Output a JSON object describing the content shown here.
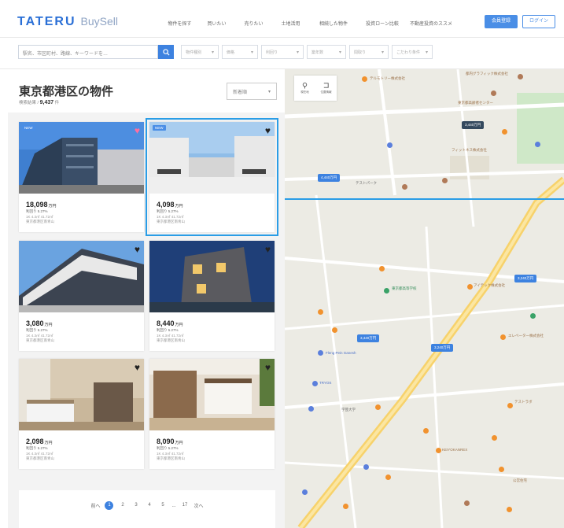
{
  "header": {
    "logo": "TATERU",
    "logo_sub": "BuySell",
    "nav": [
      "物件を探す",
      "買いたい",
      "売りたい",
      "土地活用",
      "相続した物件",
      "投資ローン比較",
      "不動産投資のススメ"
    ],
    "signup_label": "会員登録",
    "login_label": "ログイン"
  },
  "search": {
    "placeholder": "駅名、市区町村、路線、キーワードを…",
    "filters": [
      "物件種別",
      "価格",
      "利回り",
      "築年数",
      "間取り",
      "こだわり条件"
    ]
  },
  "listing": {
    "title": "東京都港区の物件",
    "result_label": "検索結果",
    "result_count": "9,437",
    "result_unit": "件",
    "sort_label": "新着順"
  },
  "cards": [
    {
      "badge": "NEW",
      "price": "18,098",
      "unit": "万円",
      "yield": "利回り 5.27%",
      "spec": "1K 4.3㎡  41.72㎡",
      "loc": "東京都港区南青山",
      "heart": "pink"
    },
    {
      "badge": "NEW",
      "price": "4,098",
      "unit": "万円",
      "yield": "利回り 5.27%",
      "spec": "1K 4.3㎡  41.72㎡",
      "loc": "東京都港区南青山",
      "heart": "dark"
    },
    {
      "badge": "",
      "price": "3,080",
      "unit": "万円",
      "yield": "利回り 5.27%",
      "spec": "1K 4.3㎡  41.72㎡",
      "loc": "東京都港区南青山",
      "heart": "dark"
    },
    {
      "badge": "",
      "price": "8,440",
      "unit": "万円",
      "yield": "利回り 5.27%",
      "spec": "1K 4.3㎡  41.72㎡",
      "loc": "東京都港区南青山",
      "heart": "dark"
    },
    {
      "badge": "",
      "price": "2,098",
      "unit": "万円",
      "yield": "利回り 5.27%",
      "spec": "1K 4.3㎡  41.72㎡",
      "loc": "東京都港区南青山",
      "heart": "dark"
    },
    {
      "badge": "",
      "price": "8,090",
      "unit": "万円",
      "yield": "利回り 5.27%",
      "spec": "1K 4.3㎡  41.72㎡",
      "loc": "東京都港区南青山",
      "heart": "dark"
    }
  ],
  "pagination": {
    "prev": "前へ",
    "pages": [
      "1",
      "2",
      "3",
      "4",
      "5"
    ],
    "ellipsis": "...",
    "last": "17",
    "next": "次へ",
    "active": "1"
  },
  "map": {
    "controls": [
      "現在地",
      "位置情報"
    ],
    "pins": [
      "3,440万円",
      "4,440万円",
      "3,240万円",
      "3,240万円",
      "3,440万円"
    ],
    "labels": [
      "テルモトリー株式会社",
      "都内グラフィック株式会社",
      "東京都高齢者センター",
      "テストパーク",
      "フィットネス株式会社",
      "東京都高等学校",
      "アイテック株式会社",
      "Fleng Pein Ganesh",
      "エレベーター株式会社",
      "TRYOS",
      "テストラボ",
      "KEIYOKANREX",
      "学芸大学",
      "公営住宅"
    ]
  },
  "colors": {
    "brand": "#2a6fd6",
    "accent": "#3d82e0",
    "selected_outline": "#2a9de6",
    "heart_pink": "#ff6fa0"
  }
}
